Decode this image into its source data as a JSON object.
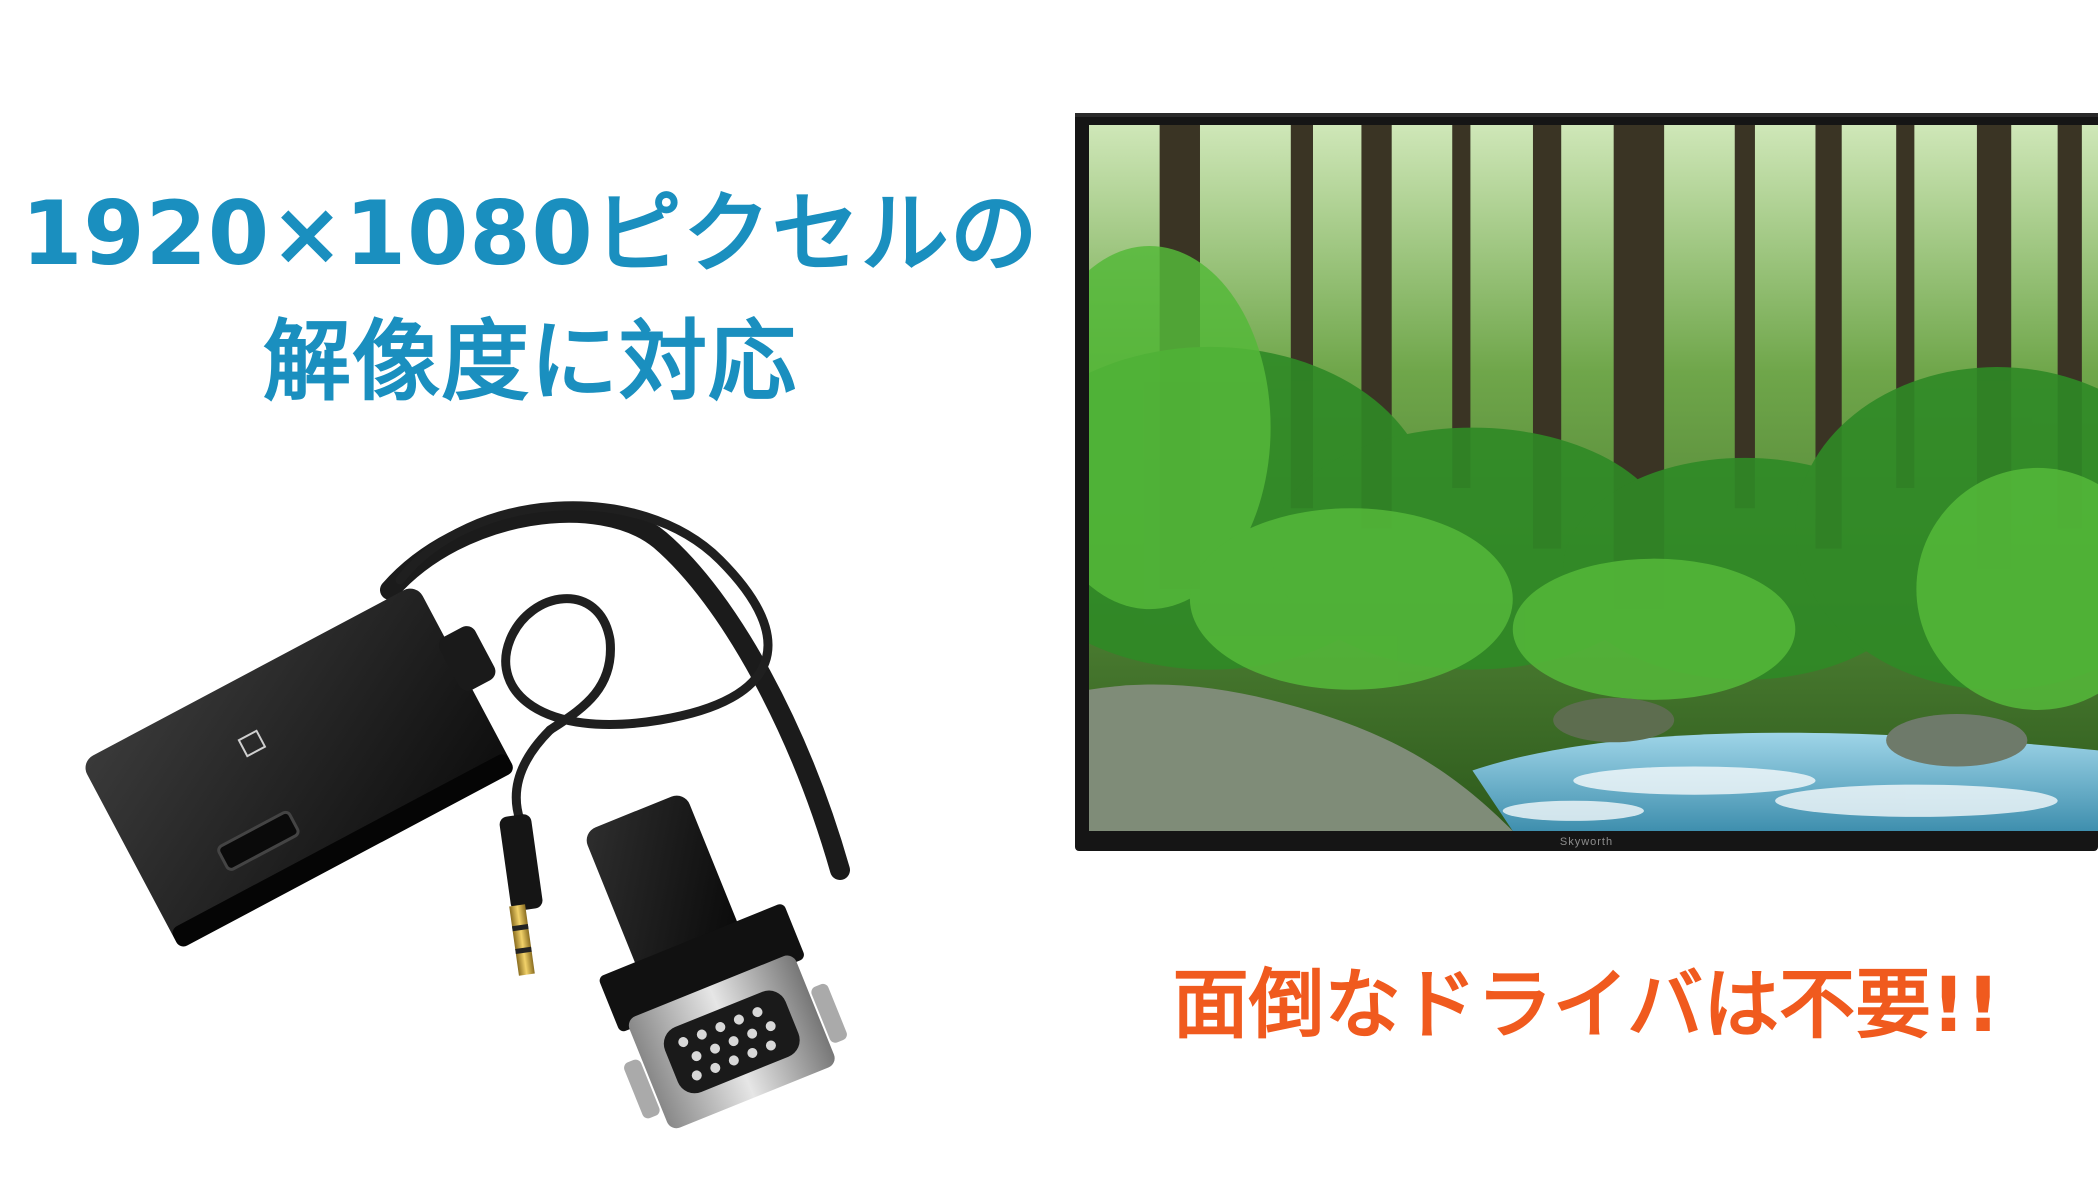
{
  "headline": {
    "line1": "1920×1080ピクセルの",
    "line2": "解像度に対応"
  },
  "tagline": "面倒なドライバは不要!!",
  "tv": {
    "brand": "Skyworth"
  },
  "colors": {
    "headline": "#1a8fbf",
    "tagline": "#f05a1e",
    "tv_frame": "#151515"
  }
}
